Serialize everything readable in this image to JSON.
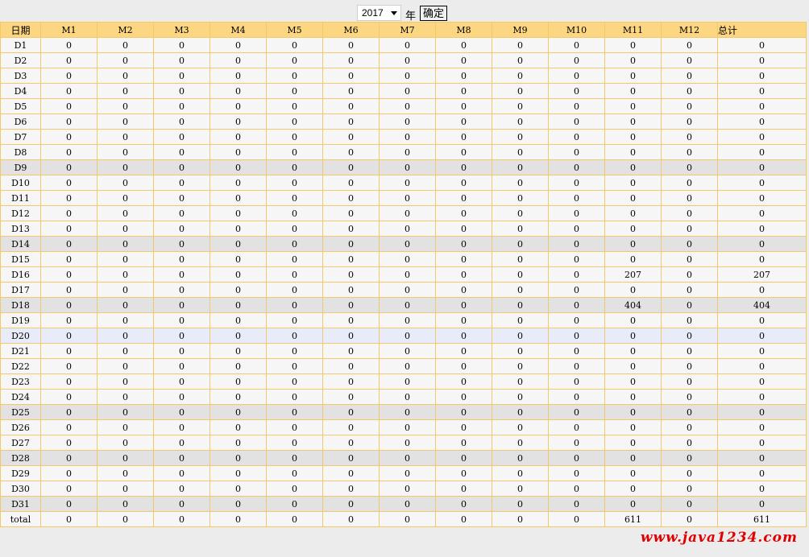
{
  "toolbar": {
    "year_value": "2017",
    "year_suffix": "年",
    "confirm_label": "确定"
  },
  "table": {
    "headers": [
      "日期",
      "M1",
      "M2",
      "M3",
      "M4",
      "M5",
      "M6",
      "M7",
      "M8",
      "M9",
      "M10",
      "M11",
      "M12",
      "总计"
    ],
    "rows": [
      {
        "label": "D1",
        "values": [
          "0",
          "0",
          "0",
          "0",
          "0",
          "0",
          "0",
          "0",
          "0",
          "0",
          "0",
          "0",
          "0"
        ],
        "style": "normal"
      },
      {
        "label": "D2",
        "values": [
          "0",
          "0",
          "0",
          "0",
          "0",
          "0",
          "0",
          "0",
          "0",
          "0",
          "0",
          "0",
          "0"
        ],
        "style": "normal"
      },
      {
        "label": "D3",
        "values": [
          "0",
          "0",
          "0",
          "0",
          "0",
          "0",
          "0",
          "0",
          "0",
          "0",
          "0",
          "0",
          "0"
        ],
        "style": "normal"
      },
      {
        "label": "D4",
        "values": [
          "0",
          "0",
          "0",
          "0",
          "0",
          "0",
          "0",
          "0",
          "0",
          "0",
          "0",
          "0",
          "0"
        ],
        "style": "normal"
      },
      {
        "label": "D5",
        "values": [
          "0",
          "0",
          "0",
          "0",
          "0",
          "0",
          "0",
          "0",
          "0",
          "0",
          "0",
          "0",
          "0"
        ],
        "style": "normal"
      },
      {
        "label": "D6",
        "values": [
          "0",
          "0",
          "0",
          "0",
          "0",
          "0",
          "0",
          "0",
          "0",
          "0",
          "0",
          "0",
          "0"
        ],
        "style": "normal"
      },
      {
        "label": "D7",
        "values": [
          "0",
          "0",
          "0",
          "0",
          "0",
          "0",
          "0",
          "0",
          "0",
          "0",
          "0",
          "0",
          "0"
        ],
        "style": "normal"
      },
      {
        "label": "D8",
        "values": [
          "0",
          "0",
          "0",
          "0",
          "0",
          "0",
          "0",
          "0",
          "0",
          "0",
          "0",
          "0",
          "0"
        ],
        "style": "normal"
      },
      {
        "label": "D9",
        "values": [
          "0",
          "0",
          "0",
          "0",
          "0",
          "0",
          "0",
          "0",
          "0",
          "0",
          "0",
          "0",
          "0"
        ],
        "style": "alt"
      },
      {
        "label": "D10",
        "values": [
          "0",
          "0",
          "0",
          "0",
          "0",
          "0",
          "0",
          "0",
          "0",
          "0",
          "0",
          "0",
          "0"
        ],
        "style": "normal"
      },
      {
        "label": "D11",
        "values": [
          "0",
          "0",
          "0",
          "0",
          "0",
          "0",
          "0",
          "0",
          "0",
          "0",
          "0",
          "0",
          "0"
        ],
        "style": "normal"
      },
      {
        "label": "D12",
        "values": [
          "0",
          "0",
          "0",
          "0",
          "0",
          "0",
          "0",
          "0",
          "0",
          "0",
          "0",
          "0",
          "0"
        ],
        "style": "normal"
      },
      {
        "label": "D13",
        "values": [
          "0",
          "0",
          "0",
          "0",
          "0",
          "0",
          "0",
          "0",
          "0",
          "0",
          "0",
          "0",
          "0"
        ],
        "style": "normal"
      },
      {
        "label": "D14",
        "values": [
          "0",
          "0",
          "0",
          "0",
          "0",
          "0",
          "0",
          "0",
          "0",
          "0",
          "0",
          "0",
          "0"
        ],
        "style": "alt"
      },
      {
        "label": "D15",
        "values": [
          "0",
          "0",
          "0",
          "0",
          "0",
          "0",
          "0",
          "0",
          "0",
          "0",
          "0",
          "0",
          "0"
        ],
        "style": "normal"
      },
      {
        "label": "D16",
        "values": [
          "0",
          "0",
          "0",
          "0",
          "0",
          "0",
          "0",
          "0",
          "0",
          "0",
          "207",
          "0",
          "207"
        ],
        "style": "normal"
      },
      {
        "label": "D17",
        "values": [
          "0",
          "0",
          "0",
          "0",
          "0",
          "0",
          "0",
          "0",
          "0",
          "0",
          "0",
          "0",
          "0"
        ],
        "style": "normal"
      },
      {
        "label": "D18",
        "values": [
          "0",
          "0",
          "0",
          "0",
          "0",
          "0",
          "0",
          "0",
          "0",
          "0",
          "404",
          "0",
          "404"
        ],
        "style": "alt"
      },
      {
        "label": "D19",
        "values": [
          "0",
          "0",
          "0",
          "0",
          "0",
          "0",
          "0",
          "0",
          "0",
          "0",
          "0",
          "0",
          "0"
        ],
        "style": "normal"
      },
      {
        "label": "D20",
        "values": [
          "0",
          "0",
          "0",
          "0",
          "0",
          "0",
          "0",
          "0",
          "0",
          "0",
          "0",
          "0",
          "0"
        ],
        "style": "hl"
      },
      {
        "label": "D21",
        "values": [
          "0",
          "0",
          "0",
          "0",
          "0",
          "0",
          "0",
          "0",
          "0",
          "0",
          "0",
          "0",
          "0"
        ],
        "style": "normal"
      },
      {
        "label": "D22",
        "values": [
          "0",
          "0",
          "0",
          "0",
          "0",
          "0",
          "0",
          "0",
          "0",
          "0",
          "0",
          "0",
          "0"
        ],
        "style": "normal"
      },
      {
        "label": "D23",
        "values": [
          "0",
          "0",
          "0",
          "0",
          "0",
          "0",
          "0",
          "0",
          "0",
          "0",
          "0",
          "0",
          "0"
        ],
        "style": "normal"
      },
      {
        "label": "D24",
        "values": [
          "0",
          "0",
          "0",
          "0",
          "0",
          "0",
          "0",
          "0",
          "0",
          "0",
          "0",
          "0",
          "0"
        ],
        "style": "normal"
      },
      {
        "label": "D25",
        "values": [
          "0",
          "0",
          "0",
          "0",
          "0",
          "0",
          "0",
          "0",
          "0",
          "0",
          "0",
          "0",
          "0"
        ],
        "style": "alt"
      },
      {
        "label": "D26",
        "values": [
          "0",
          "0",
          "0",
          "0",
          "0",
          "0",
          "0",
          "0",
          "0",
          "0",
          "0",
          "0",
          "0"
        ],
        "style": "normal"
      },
      {
        "label": "D27",
        "values": [
          "0",
          "0",
          "0",
          "0",
          "0",
          "0",
          "0",
          "0",
          "0",
          "0",
          "0",
          "0",
          "0"
        ],
        "style": "normal"
      },
      {
        "label": "D28",
        "values": [
          "0",
          "0",
          "0",
          "0",
          "0",
          "0",
          "0",
          "0",
          "0",
          "0",
          "0",
          "0",
          "0"
        ],
        "style": "alt"
      },
      {
        "label": "D29",
        "values": [
          "0",
          "0",
          "0",
          "0",
          "0",
          "0",
          "0",
          "0",
          "0",
          "0",
          "0",
          "0",
          "0"
        ],
        "style": "normal"
      },
      {
        "label": "D30",
        "values": [
          "0",
          "0",
          "0",
          "0",
          "0",
          "0",
          "0",
          "0",
          "0",
          "0",
          "0",
          "0",
          "0"
        ],
        "style": "normal"
      },
      {
        "label": "D31",
        "values": [
          "0",
          "0",
          "0",
          "0",
          "0",
          "0",
          "0",
          "0",
          "0",
          "0",
          "0",
          "0",
          "0"
        ],
        "style": "alt"
      },
      {
        "label": "total",
        "values": [
          "0",
          "0",
          "0",
          "0",
          "0",
          "0",
          "0",
          "0",
          "0",
          "0",
          "611",
          "0",
          "611"
        ],
        "style": "foot"
      }
    ]
  },
  "watermark": "www.java1234.com",
  "colors": {
    "header_bg": "#fcd680",
    "border": "#f2c86a",
    "row_bg": "#f6f6f6",
    "row_alt_bg": "#e2e2e2",
    "row_highlight_bg": "#e8ecf8",
    "watermark": "#e00000"
  }
}
